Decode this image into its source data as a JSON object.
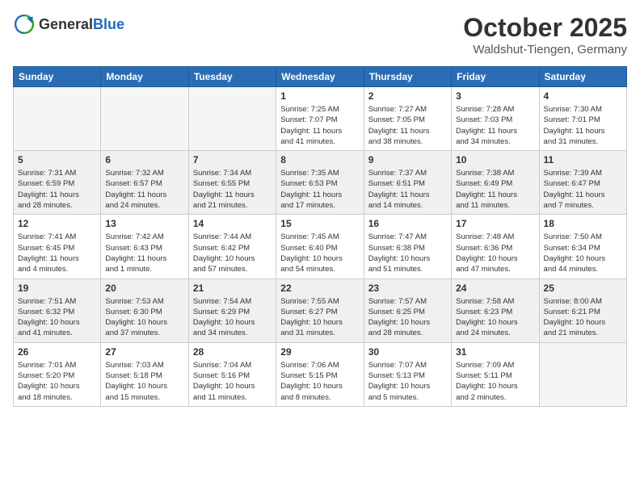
{
  "header": {
    "logo_general": "General",
    "logo_blue": "Blue",
    "month": "October 2025",
    "location": "Waldshut-Tiengen, Germany"
  },
  "days_of_week": [
    "Sunday",
    "Monday",
    "Tuesday",
    "Wednesday",
    "Thursday",
    "Friday",
    "Saturday"
  ],
  "weeks": [
    [
      {
        "day": "",
        "empty": true
      },
      {
        "day": "",
        "empty": true
      },
      {
        "day": "",
        "empty": true
      },
      {
        "day": "1",
        "lines": [
          "Sunrise: 7:25 AM",
          "Sunset: 7:07 PM",
          "Daylight: 11 hours",
          "and 41 minutes."
        ]
      },
      {
        "day": "2",
        "lines": [
          "Sunrise: 7:27 AM",
          "Sunset: 7:05 PM",
          "Daylight: 11 hours",
          "and 38 minutes."
        ]
      },
      {
        "day": "3",
        "lines": [
          "Sunrise: 7:28 AM",
          "Sunset: 7:03 PM",
          "Daylight: 11 hours",
          "and 34 minutes."
        ]
      },
      {
        "day": "4",
        "lines": [
          "Sunrise: 7:30 AM",
          "Sunset: 7:01 PM",
          "Daylight: 11 hours",
          "and 31 minutes."
        ]
      }
    ],
    [
      {
        "day": "5",
        "shaded": true,
        "lines": [
          "Sunrise: 7:31 AM",
          "Sunset: 6:59 PM",
          "Daylight: 11 hours",
          "and 28 minutes."
        ]
      },
      {
        "day": "6",
        "shaded": true,
        "lines": [
          "Sunrise: 7:32 AM",
          "Sunset: 6:57 PM",
          "Daylight: 11 hours",
          "and 24 minutes."
        ]
      },
      {
        "day": "7",
        "shaded": true,
        "lines": [
          "Sunrise: 7:34 AM",
          "Sunset: 6:55 PM",
          "Daylight: 11 hours",
          "and 21 minutes."
        ]
      },
      {
        "day": "8",
        "shaded": true,
        "lines": [
          "Sunrise: 7:35 AM",
          "Sunset: 6:53 PM",
          "Daylight: 11 hours",
          "and 17 minutes."
        ]
      },
      {
        "day": "9",
        "shaded": true,
        "lines": [
          "Sunrise: 7:37 AM",
          "Sunset: 6:51 PM",
          "Daylight: 11 hours",
          "and 14 minutes."
        ]
      },
      {
        "day": "10",
        "shaded": true,
        "lines": [
          "Sunrise: 7:38 AM",
          "Sunset: 6:49 PM",
          "Daylight: 11 hours",
          "and 11 minutes."
        ]
      },
      {
        "day": "11",
        "shaded": true,
        "lines": [
          "Sunrise: 7:39 AM",
          "Sunset: 6:47 PM",
          "Daylight: 11 hours",
          "and 7 minutes."
        ]
      }
    ],
    [
      {
        "day": "12",
        "lines": [
          "Sunrise: 7:41 AM",
          "Sunset: 6:45 PM",
          "Daylight: 11 hours",
          "and 4 minutes."
        ]
      },
      {
        "day": "13",
        "lines": [
          "Sunrise: 7:42 AM",
          "Sunset: 6:43 PM",
          "Daylight: 11 hours",
          "and 1 minute."
        ]
      },
      {
        "day": "14",
        "lines": [
          "Sunrise: 7:44 AM",
          "Sunset: 6:42 PM",
          "Daylight: 10 hours",
          "and 57 minutes."
        ]
      },
      {
        "day": "15",
        "lines": [
          "Sunrise: 7:45 AM",
          "Sunset: 6:40 PM",
          "Daylight: 10 hours",
          "and 54 minutes."
        ]
      },
      {
        "day": "16",
        "lines": [
          "Sunrise: 7:47 AM",
          "Sunset: 6:38 PM",
          "Daylight: 10 hours",
          "and 51 minutes."
        ]
      },
      {
        "day": "17",
        "lines": [
          "Sunrise: 7:48 AM",
          "Sunset: 6:36 PM",
          "Daylight: 10 hours",
          "and 47 minutes."
        ]
      },
      {
        "day": "18",
        "lines": [
          "Sunrise: 7:50 AM",
          "Sunset: 6:34 PM",
          "Daylight: 10 hours",
          "and 44 minutes."
        ]
      }
    ],
    [
      {
        "day": "19",
        "shaded": true,
        "lines": [
          "Sunrise: 7:51 AM",
          "Sunset: 6:32 PM",
          "Daylight: 10 hours",
          "and 41 minutes."
        ]
      },
      {
        "day": "20",
        "shaded": true,
        "lines": [
          "Sunrise: 7:53 AM",
          "Sunset: 6:30 PM",
          "Daylight: 10 hours",
          "and 37 minutes."
        ]
      },
      {
        "day": "21",
        "shaded": true,
        "lines": [
          "Sunrise: 7:54 AM",
          "Sunset: 6:29 PM",
          "Daylight: 10 hours",
          "and 34 minutes."
        ]
      },
      {
        "day": "22",
        "shaded": true,
        "lines": [
          "Sunrise: 7:55 AM",
          "Sunset: 6:27 PM",
          "Daylight: 10 hours",
          "and 31 minutes."
        ]
      },
      {
        "day": "23",
        "shaded": true,
        "lines": [
          "Sunrise: 7:57 AM",
          "Sunset: 6:25 PM",
          "Daylight: 10 hours",
          "and 28 minutes."
        ]
      },
      {
        "day": "24",
        "shaded": true,
        "lines": [
          "Sunrise: 7:58 AM",
          "Sunset: 6:23 PM",
          "Daylight: 10 hours",
          "and 24 minutes."
        ]
      },
      {
        "day": "25",
        "shaded": true,
        "lines": [
          "Sunrise: 8:00 AM",
          "Sunset: 6:21 PM",
          "Daylight: 10 hours",
          "and 21 minutes."
        ]
      }
    ],
    [
      {
        "day": "26",
        "lines": [
          "Sunrise: 7:01 AM",
          "Sunset: 5:20 PM",
          "Daylight: 10 hours",
          "and 18 minutes."
        ]
      },
      {
        "day": "27",
        "lines": [
          "Sunrise: 7:03 AM",
          "Sunset: 5:18 PM",
          "Daylight: 10 hours",
          "and 15 minutes."
        ]
      },
      {
        "day": "28",
        "lines": [
          "Sunrise: 7:04 AM",
          "Sunset: 5:16 PM",
          "Daylight: 10 hours",
          "and 11 minutes."
        ]
      },
      {
        "day": "29",
        "lines": [
          "Sunrise: 7:06 AM",
          "Sunset: 5:15 PM",
          "Daylight: 10 hours",
          "and 8 minutes."
        ]
      },
      {
        "day": "30",
        "lines": [
          "Sunrise: 7:07 AM",
          "Sunset: 5:13 PM",
          "Daylight: 10 hours",
          "and 5 minutes."
        ]
      },
      {
        "day": "31",
        "lines": [
          "Sunrise: 7:09 AM",
          "Sunset: 5:11 PM",
          "Daylight: 10 hours",
          "and 2 minutes."
        ]
      },
      {
        "day": "",
        "empty": true
      }
    ]
  ]
}
